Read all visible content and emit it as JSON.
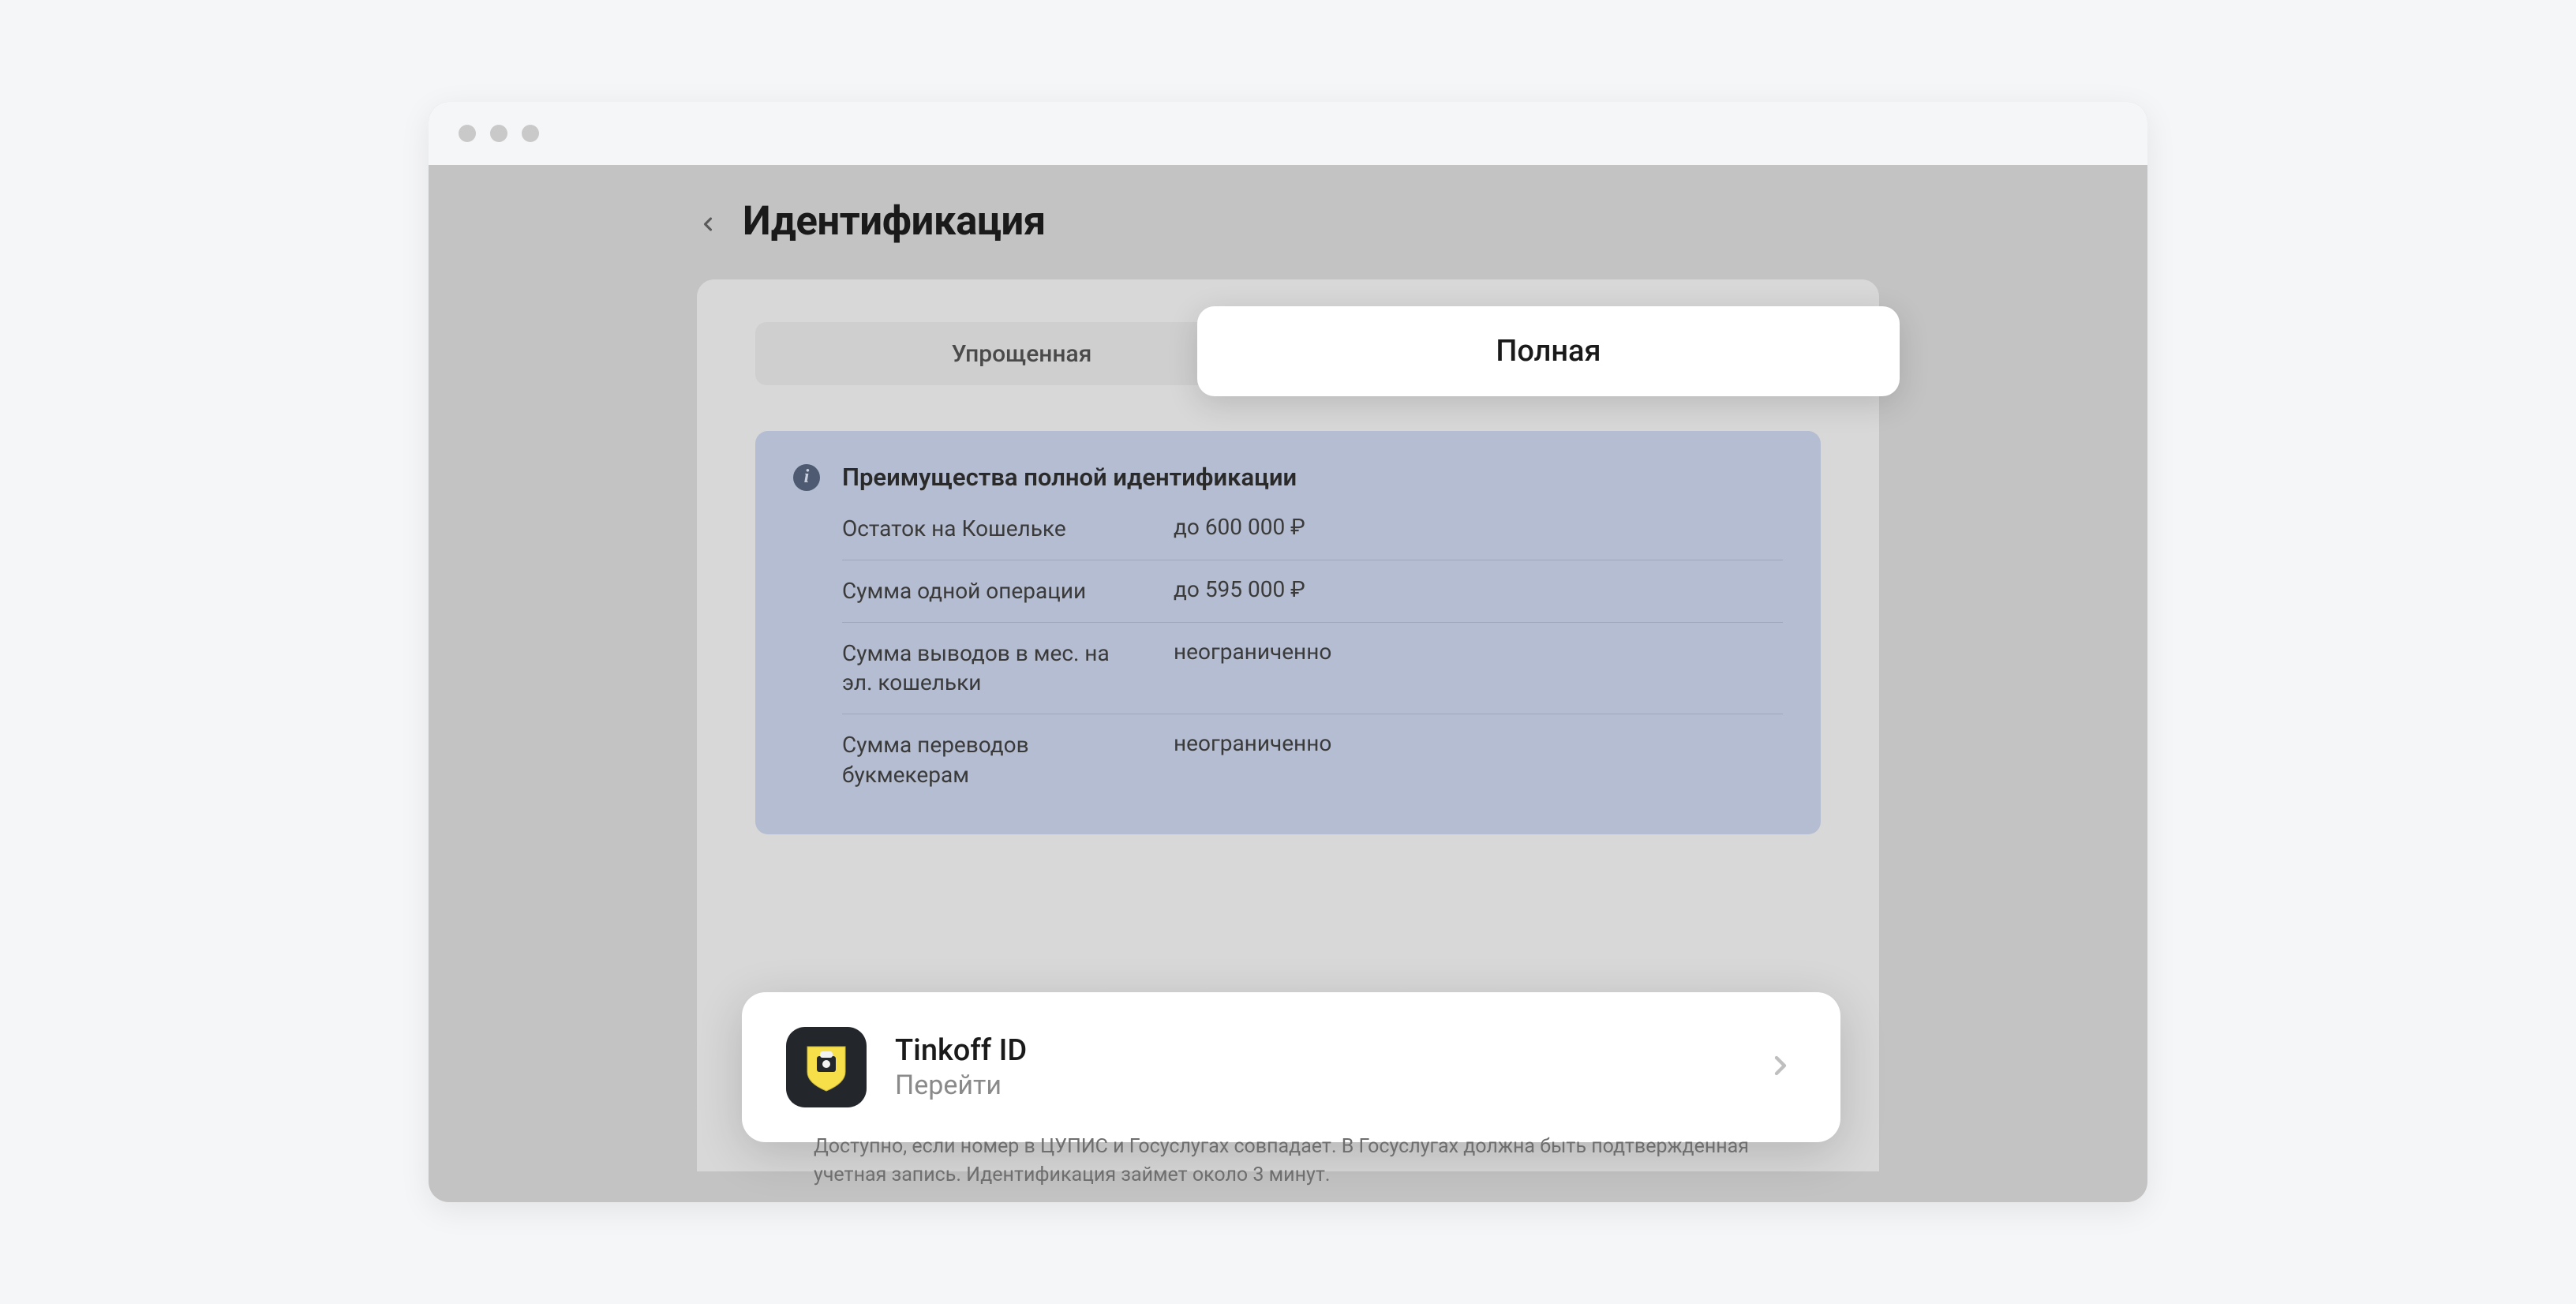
{
  "header": {
    "title": "Идентификация"
  },
  "tabs": {
    "simplified": "Упрощенная",
    "full": "Полная"
  },
  "info": {
    "title": "Преимущества полной идентификации",
    "rows": [
      {
        "label": "Остаток на Кошельке",
        "value": "до 600 000 ₽"
      },
      {
        "label": "Сумма одной операции",
        "value": "до 595 000 ₽"
      },
      {
        "label": "Сумма выводов в мес. на эл. кошельки",
        "value": "неограниченно"
      },
      {
        "label": "Сумма переводов букмекерам",
        "value": "неограниченно"
      }
    ]
  },
  "action": {
    "title": "Tinkoff ID",
    "subtitle": "Перейти"
  },
  "footnote": "Доступно, если номер в ЦУПИС и Госуслугах совпадает. В Госуслугах должна быть подтвержденная учетная запись. Идентификация займет около 3 минут."
}
